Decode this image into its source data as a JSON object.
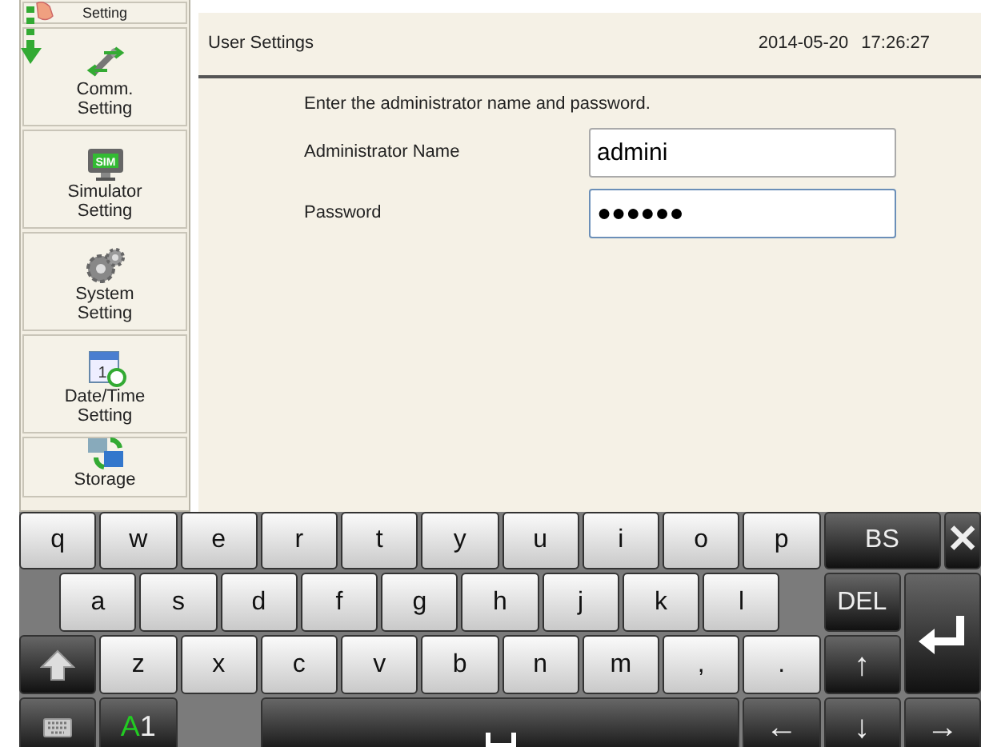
{
  "sidebar": {
    "items": [
      {
        "label": "Setting",
        "kind": "cut"
      },
      {
        "label": "Comm. Setting",
        "kind": "comm"
      },
      {
        "label": "Simulator Setting",
        "kind": "sim",
        "badge": "SIM"
      },
      {
        "label": "System Setting",
        "kind": "system"
      },
      {
        "label": "Date/Time Setting",
        "kind": "datetime",
        "badge": "1"
      },
      {
        "label": "Storage",
        "kind": "storage"
      }
    ]
  },
  "header": {
    "title": "User Settings",
    "date": "2014-05-20",
    "time": "17:26:27"
  },
  "form": {
    "instruction": "Enter the administrator name and password.",
    "fields": [
      {
        "label": "Administrator Name",
        "value": "admini",
        "focused": false
      },
      {
        "label": "Password",
        "value": "●●●●●●",
        "focused": true
      }
    ]
  },
  "keyboard": {
    "keys": [
      {
        "kind": "letter",
        "label": "q"
      },
      {
        "kind": "letter",
        "label": "w"
      },
      {
        "kind": "letter",
        "label": "e"
      },
      {
        "kind": "letter",
        "label": "r"
      },
      {
        "kind": "letter",
        "label": "t"
      },
      {
        "kind": "letter",
        "label": "y"
      },
      {
        "kind": "letter",
        "label": "u"
      },
      {
        "kind": "letter",
        "label": "i"
      },
      {
        "kind": "letter",
        "label": "o"
      },
      {
        "kind": "letter",
        "label": "p"
      },
      {
        "kind": "func",
        "label": "BS"
      },
      {
        "kind": "func",
        "label": "✕"
      },
      {
        "kind": "letter",
        "label": "a"
      },
      {
        "kind": "letter",
        "label": "s"
      },
      {
        "kind": "letter",
        "label": "d"
      },
      {
        "kind": "letter",
        "label": "f"
      },
      {
        "kind": "letter",
        "label": "g"
      },
      {
        "kind": "letter",
        "label": "h"
      },
      {
        "kind": "letter",
        "label": "j"
      },
      {
        "kind": "letter",
        "label": "k"
      },
      {
        "kind": "letter",
        "label": "l"
      },
      {
        "kind": "func",
        "label": "DEL"
      },
      {
        "kind": "enter"
      },
      {
        "kind": "shift"
      },
      {
        "kind": "letter",
        "label": "z"
      },
      {
        "kind": "letter",
        "label": "x"
      },
      {
        "kind": "letter",
        "label": "c"
      },
      {
        "kind": "letter",
        "label": "v"
      },
      {
        "kind": "letter",
        "label": "b"
      },
      {
        "kind": "letter",
        "label": "n"
      },
      {
        "kind": "letter",
        "label": "m"
      },
      {
        "kind": "letter",
        "label": ","
      },
      {
        "kind": "letter",
        "label": "."
      },
      {
        "kind": "func",
        "label": "↑"
      },
      {
        "kind": "keyboard"
      },
      {
        "kind": "mode",
        "label": "A",
        "sublabel": "1"
      },
      {
        "kind": "space"
      },
      {
        "kind": "func",
        "label": "←"
      },
      {
        "kind": "func",
        "label": "↓"
      },
      {
        "kind": "func",
        "label": "→"
      }
    ]
  }
}
